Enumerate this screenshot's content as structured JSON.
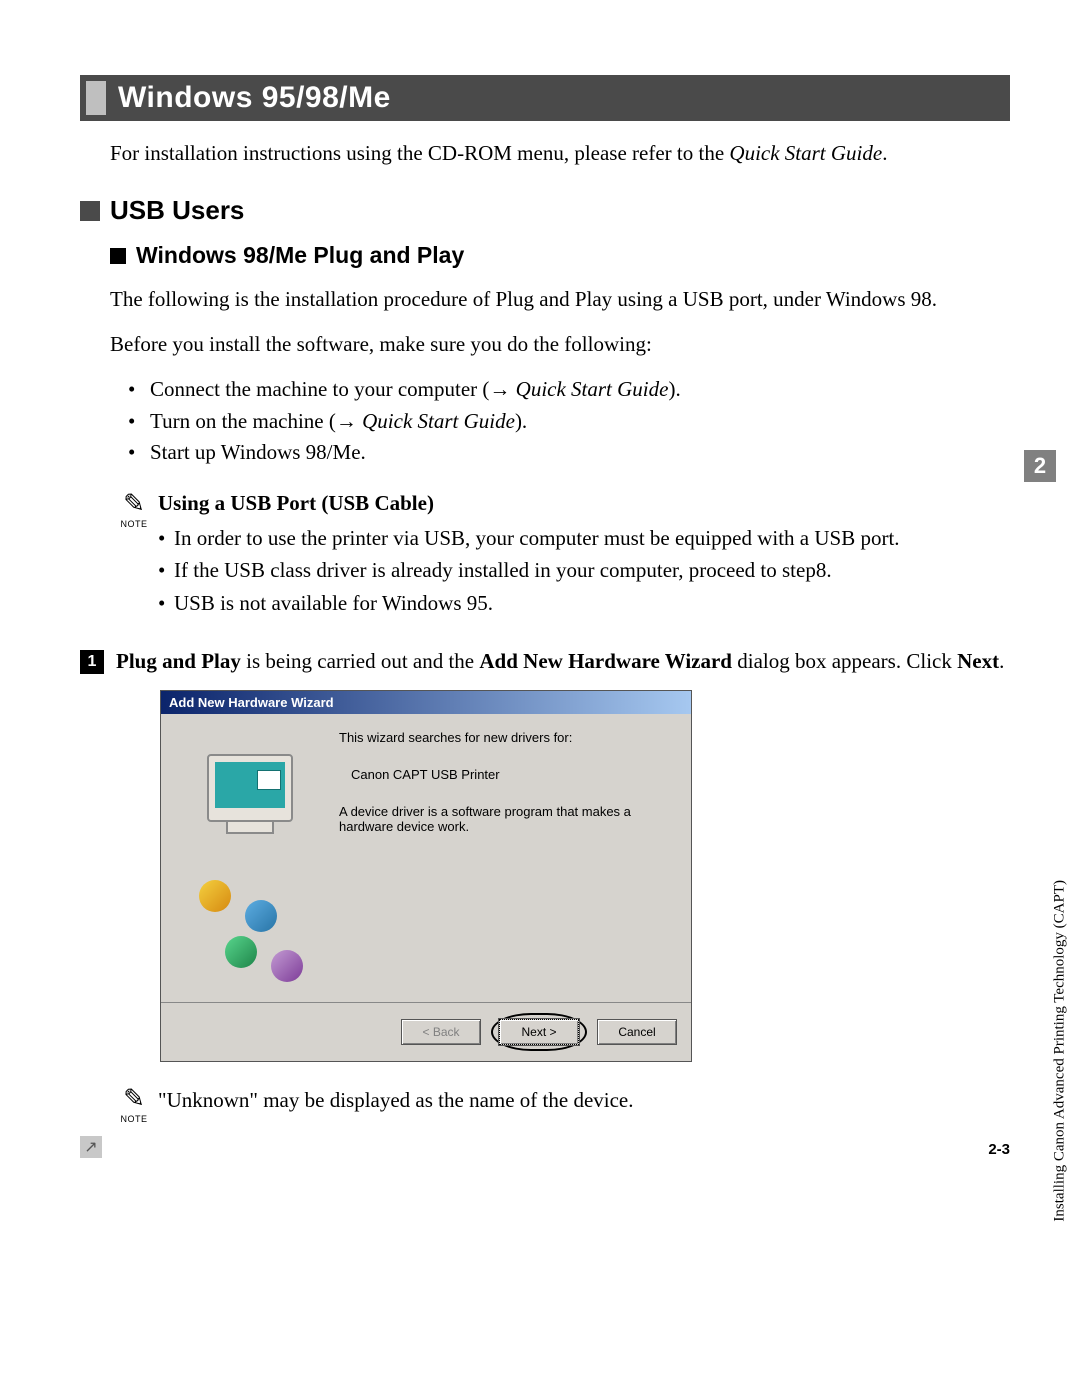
{
  "heading_main": "Windows 95/98/Me",
  "intro": "For installation instructions using the CD-ROM menu, please refer to the ",
  "intro_ref": "Quick Start Guide",
  "intro_end": ".",
  "h2": "USB Users",
  "h3": "Windows 98/Me Plug and Play",
  "p1": "The following is the installation procedure of Plug and Play using a USB port, under Windows 98.",
  "p2": "Before you install the software, make sure you do the following:",
  "bullets": {
    "b1a": "Connect the machine to your computer (→ ",
    "b1b": "Quick Start Guide",
    "b1c": ").",
    "b2a": "Turn on the machine (→ ",
    "b2b": "Quick Start Guide",
    "b2c": ").",
    "b3": "Start up Windows 98/Me."
  },
  "note_label": "NOTE",
  "note_title": "Using a USB Port (USB Cable)",
  "note_items": {
    "n1": "In order to use the printer via USB, your computer must be equipped with a USB port.",
    "n2": "If the USB class driver is already installed in your computer, proceed to step8.",
    "n3": "USB is not available for Windows 95."
  },
  "step1_num": "1",
  "step1_a": "Plug and Play",
  "step1_b": " is being carried out and the ",
  "step1_c": "Add New Hardware Wizard",
  "step1_d": " dialog box appears. Click ",
  "step1_e": "Next",
  "step1_f": ".",
  "dialog": {
    "title": "Add New Hardware Wizard",
    "line1": "This wizard searches for new drivers for:",
    "line2": "Canon CAPT USB Printer",
    "line3": "A device driver is a software program that makes a hardware device work.",
    "back": "< Back",
    "next": "Next >",
    "cancel": "Cancel"
  },
  "note2_text": "\"Unknown\" may be displayed as the name of the device.",
  "side_chapter": "2",
  "side_text": "Installing Canon Advanced Printing Technology (CAPT)",
  "page_number": "2-3",
  "corner_glyph": "↗"
}
